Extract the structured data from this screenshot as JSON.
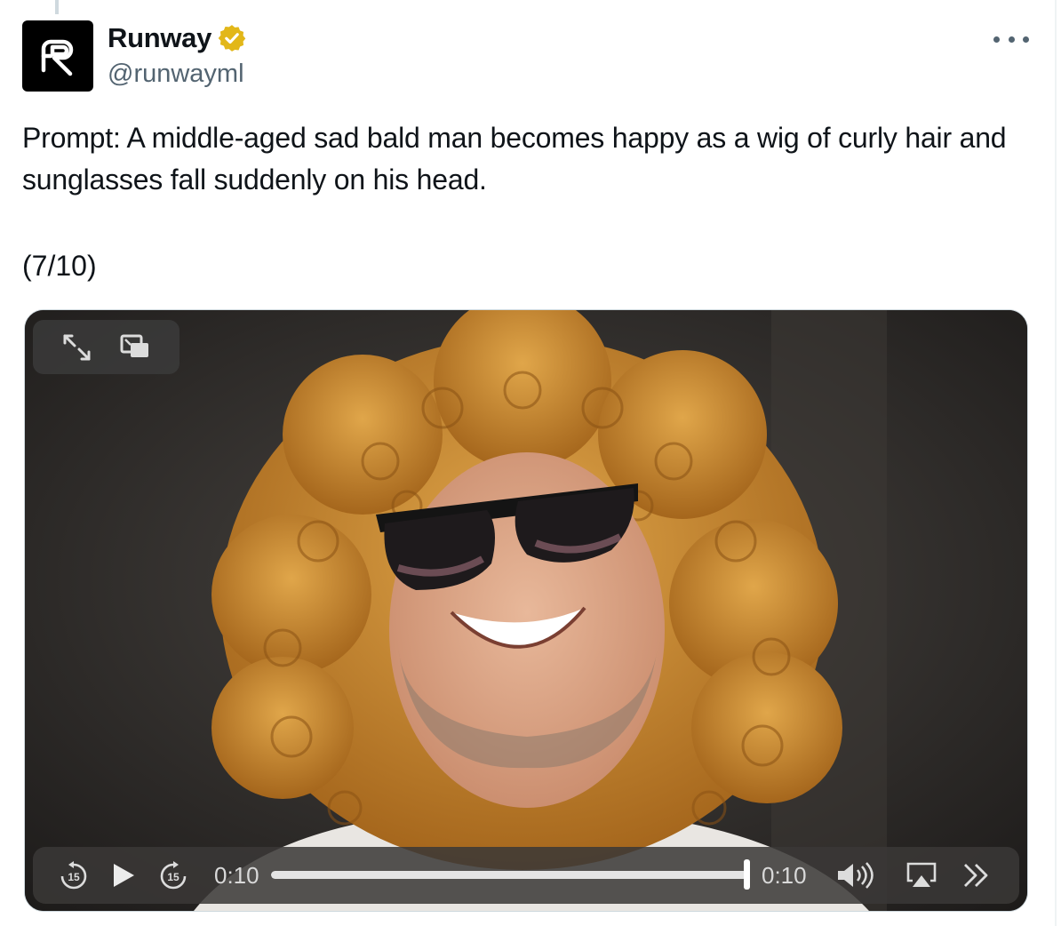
{
  "author": {
    "display_name": "Runway",
    "handle": "@runwayml",
    "verified_badge_color": "#E2B719",
    "avatar_icon": "runway-logo"
  },
  "tweet": {
    "text": "Prompt: A middle-aged sad bald man becomes happy as a wig of curly hair and sunglasses fall suddenly on his head.",
    "counter": "(7/10)"
  },
  "menu": {
    "more_icon": "more-horizontal-icon"
  },
  "video": {
    "top_controls": [
      "expand-icon",
      "picture-in-picture-icon"
    ],
    "controls": {
      "skip_back_label": "15",
      "skip_forward_label": "15",
      "current_time": "0:10",
      "total_time": "0:10",
      "progress": 1.0,
      "icons": [
        "skip-back-15-icon",
        "play-icon",
        "skip-forward-15-icon",
        "volume-icon",
        "airplay-icon",
        "fast-forward-icon"
      ]
    }
  },
  "colors": {
    "text": "#0F1419",
    "secondary_text": "#536471",
    "wig": "#C8842A",
    "background": "#FFFFFF"
  }
}
